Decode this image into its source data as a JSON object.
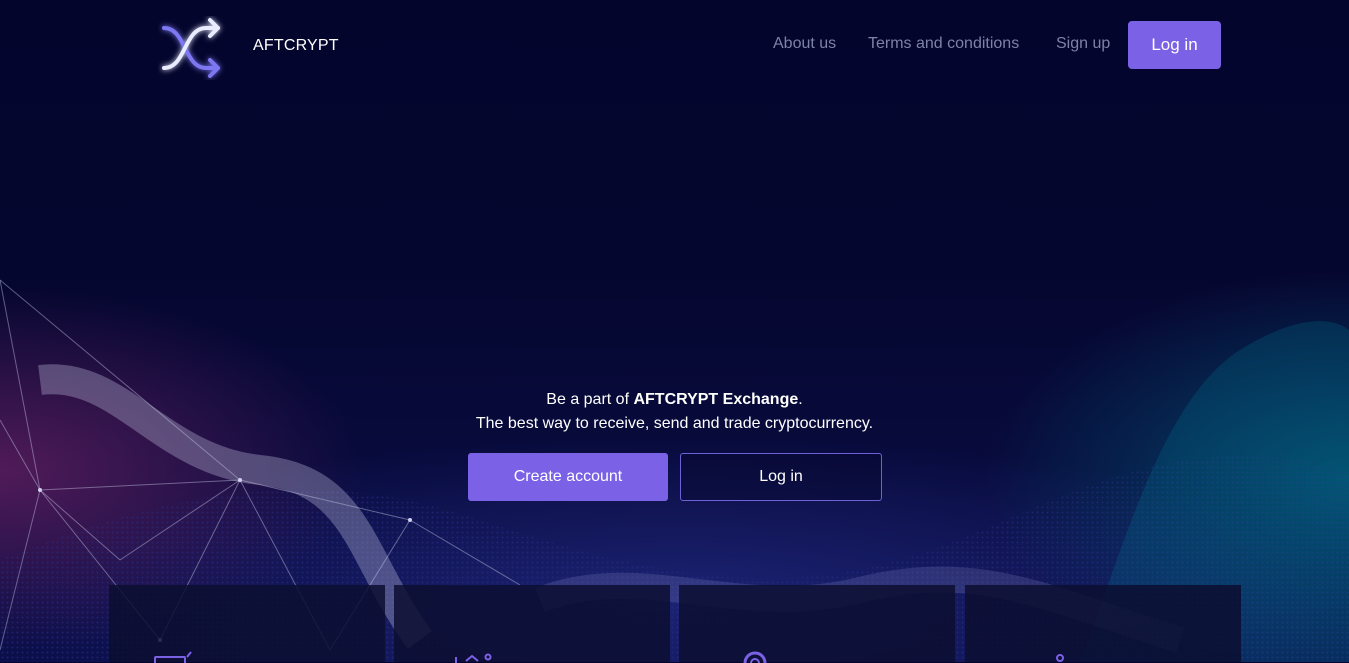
{
  "header": {
    "brand": "AFTCRYPT",
    "nav": {
      "about": "About us",
      "terms": "Terms and conditions",
      "signup": "Sign up",
      "login": "Log in"
    }
  },
  "hero": {
    "line1_prefix": "Be a part of ",
    "line1_strong": "AFTCRYPT Exchange",
    "line1_suffix": ".",
    "line2": "The best way to receive, send and trade cryptocurrency.",
    "create_label": "Create account",
    "login_label": "Log in"
  },
  "colors": {
    "accent": "#7b61e6",
    "background": "#05062f",
    "nav_text": "#7d82a8"
  },
  "cards": [
    {
      "icon": "wallet-icon"
    },
    {
      "icon": "transfer-icon"
    },
    {
      "icon": "gear-icon"
    },
    {
      "icon": "user-icon"
    }
  ]
}
